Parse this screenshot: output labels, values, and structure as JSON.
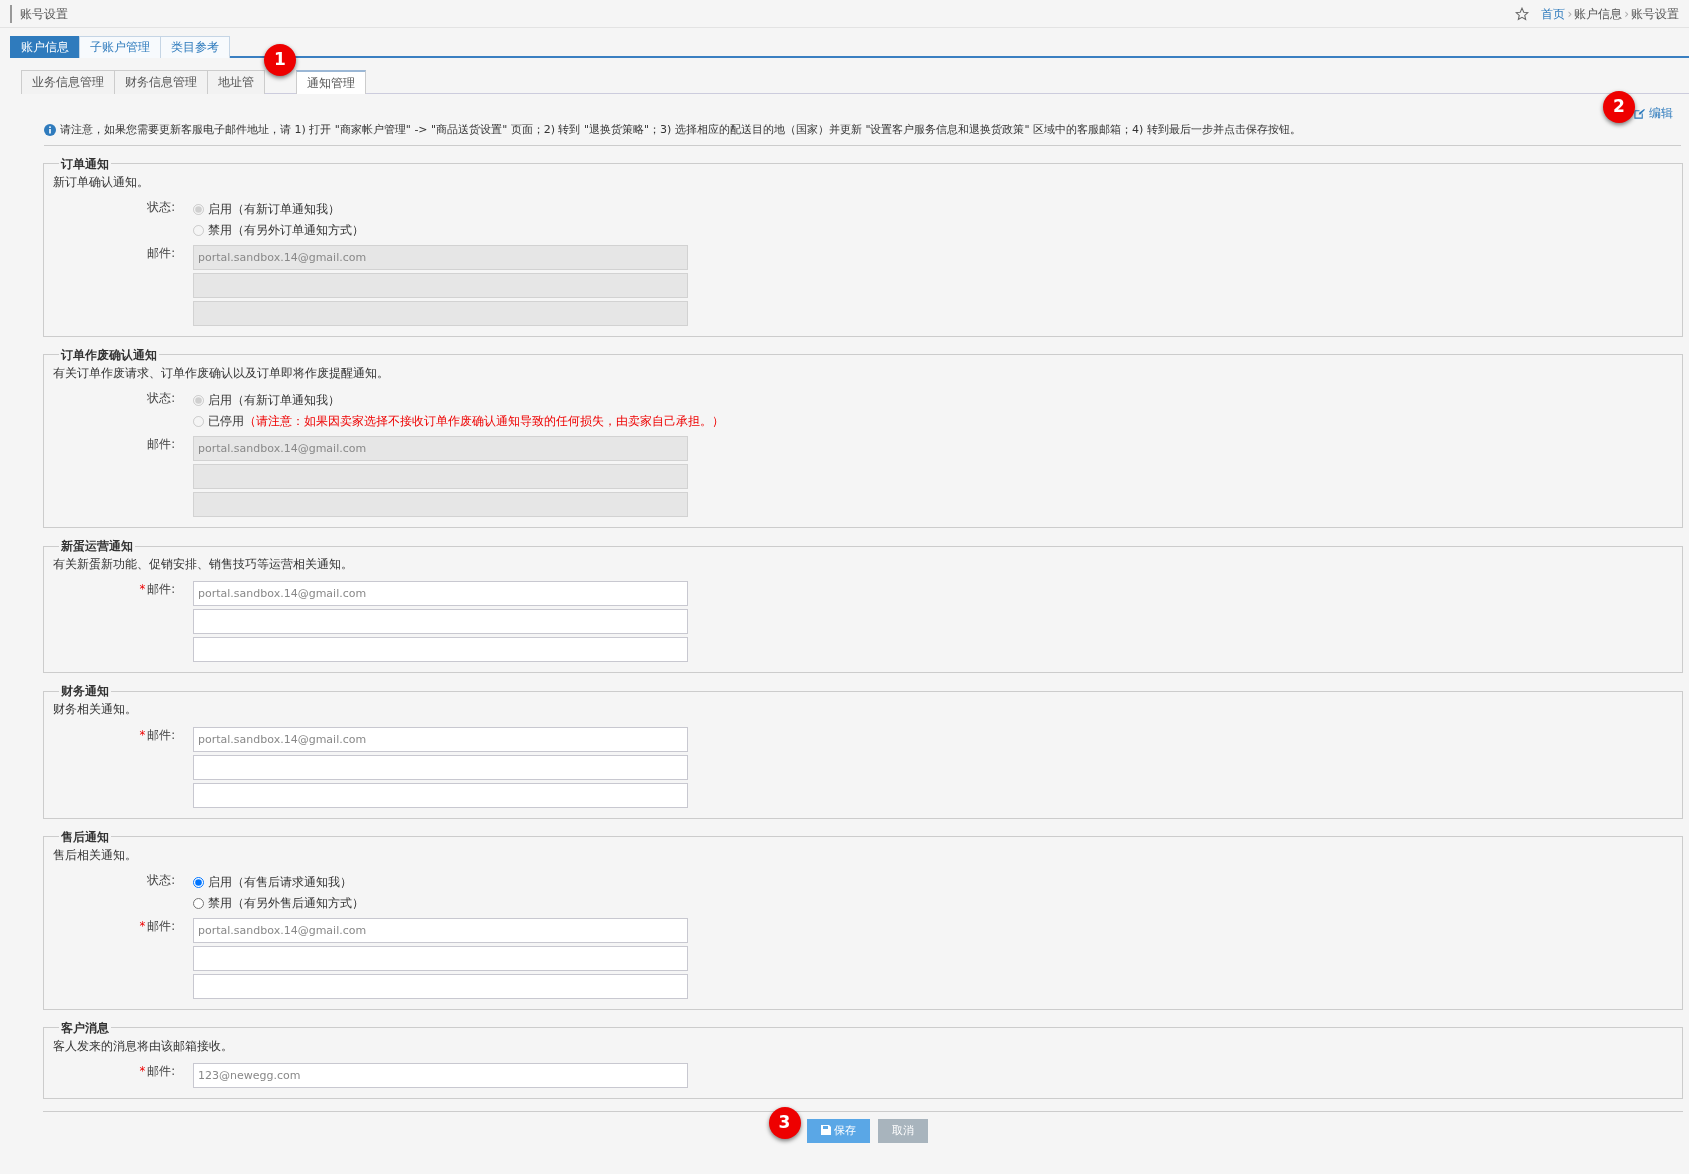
{
  "page_title": "账号设置",
  "breadcrumb_separator": "›",
  "breadcrumb": [
    {
      "label": "首页",
      "link": true
    },
    {
      "label": "账户信息",
      "link": false
    },
    {
      "label": "账号设置",
      "link": false
    }
  ],
  "tabs": [
    {
      "label": "账户信息",
      "selected": true
    },
    {
      "label": "子账户管理",
      "selected": false
    },
    {
      "label": "类目参考",
      "selected": false
    }
  ],
  "subtabs": [
    {
      "label": "业务信息管理",
      "selected": false
    },
    {
      "label": "财务信息管理",
      "selected": false
    },
    {
      "label": "地址管",
      "selected": false
    },
    {
      "label": "通知管理",
      "selected": true
    }
  ],
  "callouts": [
    "1",
    "2",
    "3"
  ],
  "edit_link": "编辑",
  "notice": "请注意，如果您需要更新客服电子邮件地址，请 1) 打开 \"商家帐户管理\" -> \"商品送货设置\" 页面；2) 转到 \"退换货策略\"；3) 选择相应的配送目的地（国家）并更新 \"设置客户服务信息和退换货政策\" 区域中的客服邮箱；4) 转到最后一步并点击保存按钮。",
  "sections": [
    {
      "title": "订单通知",
      "description": "新订单确认通知。",
      "status_label": "状态:",
      "options": [
        {
          "label": "启用（有新订单通知我）",
          "selected": true,
          "disabled": true
        },
        {
          "label": "禁用（有另外订单通知方式）",
          "selected": false,
          "disabled": true
        }
      ],
      "email_label": "邮件:",
      "required": false,
      "disabled": true,
      "emails": [
        {
          "kind": "filled",
          "placeholder": "portal.sandbox.14@gmail.com"
        },
        {
          "kind": "blank"
        },
        {
          "kind": "blank"
        }
      ]
    },
    {
      "title": "订单作废确认通知",
      "description": "有关订单作废请求、订单作废确认以及订单即将作废提醒通知。",
      "status_label": "状态:",
      "options": [
        {
          "label": "启用（有新订单通知我）",
          "selected": true,
          "disabled": true
        },
        {
          "label": "已停用",
          "note": "（请注意：如果因卖家选择不接收订单作废确认通知导致的任何损失，由卖家自己承担。）",
          "selected": false,
          "disabled": true
        }
      ],
      "email_label": "邮件:",
      "required": false,
      "disabled": true,
      "emails": [
        {
          "kind": "filled",
          "placeholder": "portal.sandbox.14@gmail.com"
        },
        {
          "kind": "blank"
        },
        {
          "kind": "blank"
        }
      ]
    },
    {
      "title": "新蛋运营通知",
      "description": "有关新蛋新功能、促销安排、销售技巧等运营相关通知。",
      "email_label": "邮件:",
      "required": true,
      "disabled": false,
      "emails": [
        {
          "kind": "filled",
          "placeholder": "portal.sandbox.14@gmail.com"
        },
        {
          "kind": "blank"
        },
        {
          "kind": "blank"
        }
      ]
    },
    {
      "title": "财务通知",
      "description": "财务相关通知。",
      "email_label": "邮件:",
      "required": true,
      "disabled": false,
      "emails": [
        {
          "kind": "filled",
          "placeholder": "portal.sandbox.14@gmail.com"
        },
        {
          "kind": "blank"
        },
        {
          "kind": "blank"
        }
      ]
    },
    {
      "title": "售后通知",
      "description": "售后相关通知。",
      "status_label": "状态:",
      "options": [
        {
          "label": "启用（有售后请求通知我）",
          "selected": true,
          "disabled": false
        },
        {
          "label": "禁用（有另外售后通知方式）",
          "selected": false,
          "disabled": false
        }
      ],
      "email_label": "邮件:",
      "required": true,
      "disabled": false,
      "emails": [
        {
          "kind": "filled",
          "placeholder": "portal.sandbox.14@gmail.com"
        },
        {
          "kind": "blank"
        },
        {
          "kind": "blank"
        }
      ]
    },
    {
      "title": "客户消息",
      "description": "客人发来的消息将由该邮箱接收。",
      "email_label": "邮件:",
      "required": true,
      "disabled": false,
      "emails": [
        {
          "kind": "filled",
          "placeholder": "123@newegg.com"
        }
      ]
    }
  ],
  "required_mark": "*",
  "buttons": [
    {
      "label": "保存",
      "kind": "primary"
    },
    {
      "label": "取消",
      "kind": "secondary"
    }
  ]
}
